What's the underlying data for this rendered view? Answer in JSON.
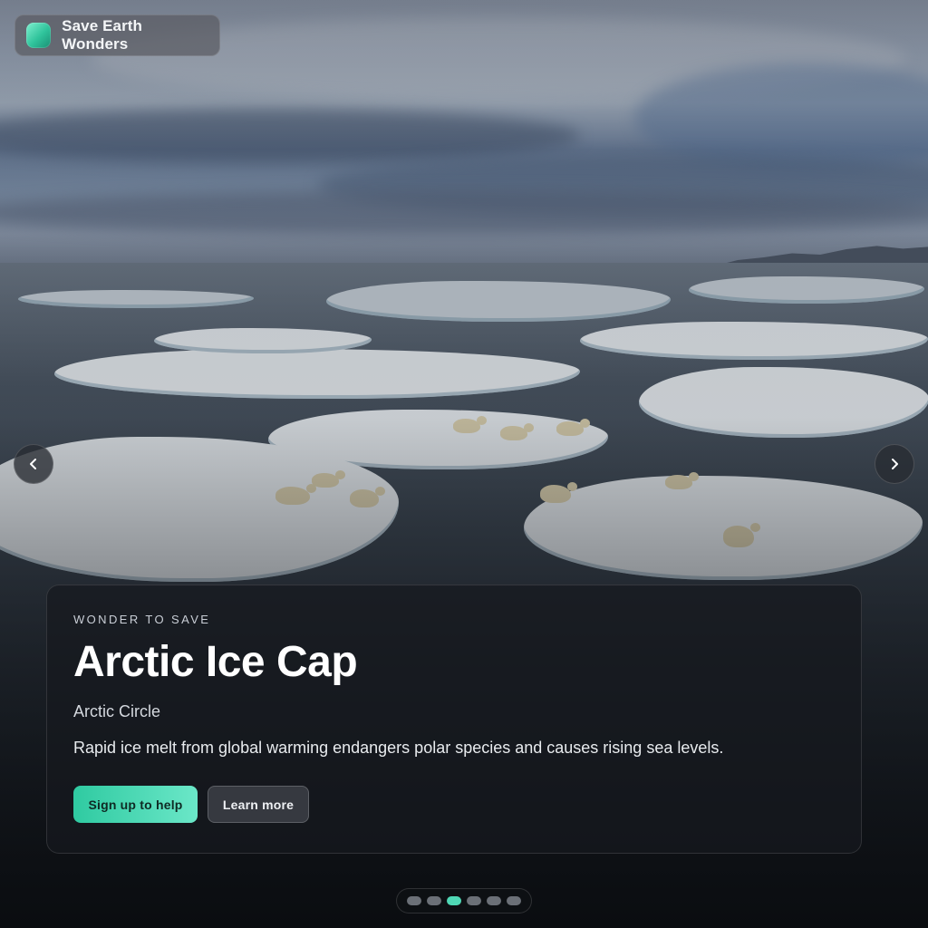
{
  "brand": {
    "name": "Save Earth Wonders",
    "logo_icon": "brand-logo-icon"
  },
  "carousel": {
    "prev_icon": "chevron-left-icon",
    "next_icon": "chevron-right-icon",
    "slide_count": 6,
    "active_slide": 3
  },
  "card": {
    "eyebrow": "WONDER TO SAVE",
    "title": "Arctic Ice Cap",
    "location": "Arctic Circle",
    "description": "Rapid ice melt from global warming endangers polar species and causes rising sea levels.",
    "primary_label": "Sign up to help",
    "secondary_label": "Learn more"
  },
  "colors": {
    "accent": "#4fd8b5",
    "accent_gradient_end": "#6be7c8"
  }
}
